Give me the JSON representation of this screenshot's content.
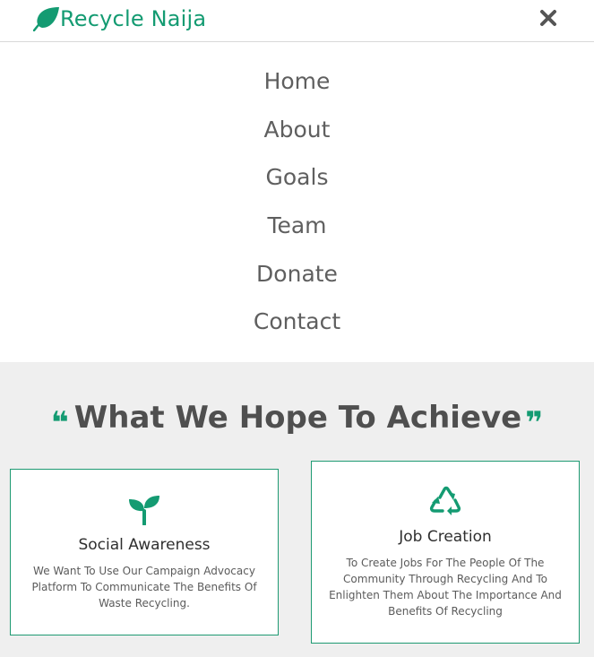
{
  "header": {
    "brand": "Recycle Naija",
    "brand_icon": "leaf-icon",
    "close_icon": "close-icon"
  },
  "nav": {
    "items": [
      {
        "label": "Home"
      },
      {
        "label": "About"
      },
      {
        "label": "Goals"
      },
      {
        "label": "Team"
      },
      {
        "label": "Donate"
      },
      {
        "label": "Contact"
      }
    ]
  },
  "goals": {
    "title": "What We Hope To Achieve",
    "quote_open": "❝",
    "quote_close": "❞",
    "cards": [
      {
        "icon": "sprout-icon",
        "title": "Social Awareness",
        "text": "We Want To Use Our Campaign Advocacy Platform To Communicate The Benefits Of Waste Recycling."
      },
      {
        "icon": "recycle-icon",
        "title": "Job Creation",
        "text": "To Create Jobs For The People Of The Community Through Recycling And To Enlighten Them About The Importance And Benefits Of Recycling"
      }
    ]
  },
  "colors": {
    "accent": "#149b72",
    "text": "#5f5f5f",
    "section_bg": "#efefef"
  }
}
